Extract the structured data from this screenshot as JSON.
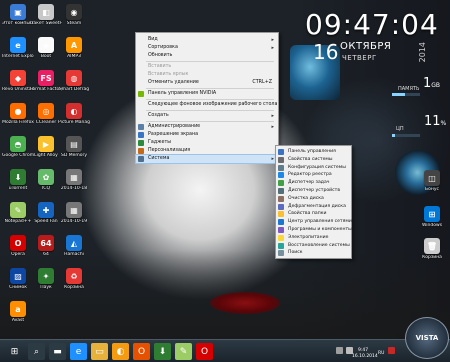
{
  "desktop": {
    "icons": [
      {
        "label": "Этот компьютер",
        "color": "#3a7bd5",
        "glyph": "▣"
      },
      {
        "label": "Пакет SweetHome",
        "color": "#c8c8c8",
        "glyph": "◧"
      },
      {
        "label": "Steam",
        "color": "#333333",
        "glyph": "◉"
      },
      {
        "label": "Internet Explorer",
        "color": "#1e90ff",
        "glyph": "e"
      },
      {
        "label": "Boot",
        "color": "#fafafa",
        "glyph": "◈"
      },
      {
        "label": "AIMP3",
        "color": "#ff9800",
        "glyph": "A"
      },
      {
        "label": "Revo Uninstaller",
        "color": "#f44336",
        "glyph": "◆"
      },
      {
        "label": "Format Factory",
        "color": "#e91e63",
        "glyph": "FS"
      },
      {
        "label": "Smart Defrag",
        "color": "#e53935",
        "glyph": "◍"
      },
      {
        "label": "Mozilla Firefox",
        "color": "#ff6d00",
        "glyph": "●"
      },
      {
        "label": "CCleaner",
        "color": "#ff6f00",
        "glyph": "◎"
      },
      {
        "label": "Picture Manager",
        "color": "#d32f2f",
        "glyph": "◐"
      },
      {
        "label": "Google Chrome",
        "color": "#4caf50",
        "glyph": "◓"
      },
      {
        "label": "Light Alloy",
        "color": "#fbc02d",
        "glyph": "▶"
      },
      {
        "label": "SD Memory",
        "color": "#555555",
        "glyph": "▤"
      },
      {
        "label": "uTorrent",
        "color": "#2e7d32",
        "glyph": "⬇"
      },
      {
        "label": "ICQ",
        "color": "#66bb6a",
        "glyph": "✿"
      },
      {
        "label": "2014-10-18",
        "color": "#777777",
        "glyph": "▦"
      },
      {
        "label": "Notepad++",
        "color": "#9ccc65",
        "glyph": "✎"
      },
      {
        "label": "Speed Fan",
        "color": "#1565c0",
        "glyph": "✚"
      },
      {
        "label": "2014-10-19",
        "color": "#777777",
        "glyph": "▦"
      },
      {
        "label": "Opera",
        "color": "#d50000",
        "glyph": "O"
      },
      {
        "label": "64",
        "color": "#b71c1c",
        "glyph": "64"
      },
      {
        "label": "Hamachi",
        "color": "#1976d2",
        "glyph": "◭"
      },
      {
        "label": "Снимок",
        "color": "#0d47a1",
        "glyph": "▨"
      },
      {
        "label": "Паук",
        "color": "#2e7d32",
        "glyph": "✦"
      },
      {
        "label": "Корзина",
        "color": "#e53935",
        "glyph": "♻"
      },
      {
        "label": "Avast",
        "color": "#ff8f00",
        "glyph": "a"
      }
    ],
    "right_icons": [
      {
        "label": "Бонус",
        "color": "#444444",
        "glyph": "◫"
      },
      {
        "label": "Windows",
        "color": "#0078d7",
        "glyph": "⊞"
      },
      {
        "label": "Корзина",
        "color": "#cccccc",
        "glyph": "🗑"
      }
    ]
  },
  "clock": {
    "time": "09:47:04",
    "day": "16",
    "month": "ОКТЯБРЯ",
    "weekday": "ЧЕТВЕРГ",
    "year": "2014",
    "mem_label": "ПАМЯТЬ",
    "mem_value": "1",
    "mem_unit": "GB",
    "mem_fraction": 0.45,
    "cpu_label": "ЦП",
    "cpu_value": "11",
    "cpu_unit": "%",
    "cpu_fraction": 0.11
  },
  "context_menu": {
    "items": [
      {
        "label": "Вид",
        "arrow": "▸",
        "disabled": false
      },
      {
        "label": "Сортировка",
        "arrow": "▸",
        "disabled": false
      },
      {
        "label": "Обновить",
        "arrow": "",
        "disabled": false
      },
      {
        "sep": true
      },
      {
        "label": "Вставить",
        "arrow": "",
        "disabled": true
      },
      {
        "label": "Вставить ярлык",
        "arrow": "",
        "disabled": true
      },
      {
        "label": "Отменить удаление",
        "shortcut": "CTRL+Z",
        "disabled": false
      },
      {
        "sep": true
      },
      {
        "label": "Панель управления NVIDIA",
        "icon_color": "#76b900",
        "disabled": false
      },
      {
        "sep": true
      },
      {
        "label": "Следующее фоновое изображение рабочего стола",
        "disabled": false
      },
      {
        "sep": true
      },
      {
        "label": "Создать",
        "arrow": "▸",
        "disabled": false
      },
      {
        "sep": true
      },
      {
        "label": "Администрирование",
        "arrow": "▸",
        "icon_color": "#5b7fa6",
        "disabled": false
      },
      {
        "label": "Разрешение экрана",
        "icon_color": "#3a74c5",
        "disabled": false
      },
      {
        "label": "Гаджеты",
        "icon_color": "#2b8a3e",
        "disabled": false
      },
      {
        "label": "Персонализация",
        "icon_color": "#c06a1a",
        "disabled": false
      },
      {
        "label": "Система",
        "arrow": "▸",
        "icon_color": "#4f6f8f",
        "disabled": false,
        "highlighted": true
      }
    ]
  },
  "submenu": {
    "items": [
      {
        "label": "Панель управления",
        "icon_color": "#3a74c5"
      },
      {
        "label": "Свойства системы",
        "icon_color": "#6b6b6b"
      },
      {
        "label": "Конфигурация системы",
        "icon_color": "#607d8b"
      },
      {
        "label": "Редактор реестра",
        "icon_color": "#1e88e5"
      },
      {
        "label": "Диспетчер задач",
        "icon_color": "#43a047"
      },
      {
        "label": "Диспетчер устройств",
        "icon_color": "#546e7a"
      },
      {
        "label": "Очистка диска",
        "icon_color": "#8d6e63"
      },
      {
        "label": "Дефрагментация диска",
        "icon_color": "#5c6bc0"
      },
      {
        "label": "Свойства папки",
        "icon_color": "#fbc02d"
      },
      {
        "label": "Центр управления сетями",
        "icon_color": "#1976d2"
      },
      {
        "label": "Программы и компоненты",
        "icon_color": "#7e57c2"
      },
      {
        "label": "Электропитание",
        "icon_color": "#fdd835"
      },
      {
        "label": "Восстановление системы",
        "icon_color": "#26a69a"
      },
      {
        "label": "Поиск",
        "icon_color": "#78909c"
      }
    ]
  },
  "taskbar": {
    "start_glyph": "⊞",
    "buttons": [
      {
        "name": "search",
        "glyph": "⌕",
        "color": "#2c3a44"
      },
      {
        "name": "file-explorer",
        "glyph": "▬",
        "color": "#2c3a44"
      },
      {
        "name": "internet-explorer",
        "glyph": "e",
        "color": "#1e90ff"
      },
      {
        "name": "folder",
        "glyph": "▭",
        "color": "#e6b23c"
      },
      {
        "name": "app-yellow",
        "glyph": "◐",
        "color": "#f39c12"
      },
      {
        "name": "office",
        "glyph": "O",
        "color": "#e65100"
      },
      {
        "name": "utorrent",
        "glyph": "⬇",
        "color": "#2e7d32"
      },
      {
        "name": "notepad",
        "glyph": "✎",
        "color": "#9ccc65"
      },
      {
        "name": "opera",
        "glyph": "O",
        "color": "#d50000"
      }
    ],
    "tray_time": "9:47",
    "tray_date": "16.10.2014",
    "tray_lang": "RU",
    "watermark": "VISTA"
  }
}
